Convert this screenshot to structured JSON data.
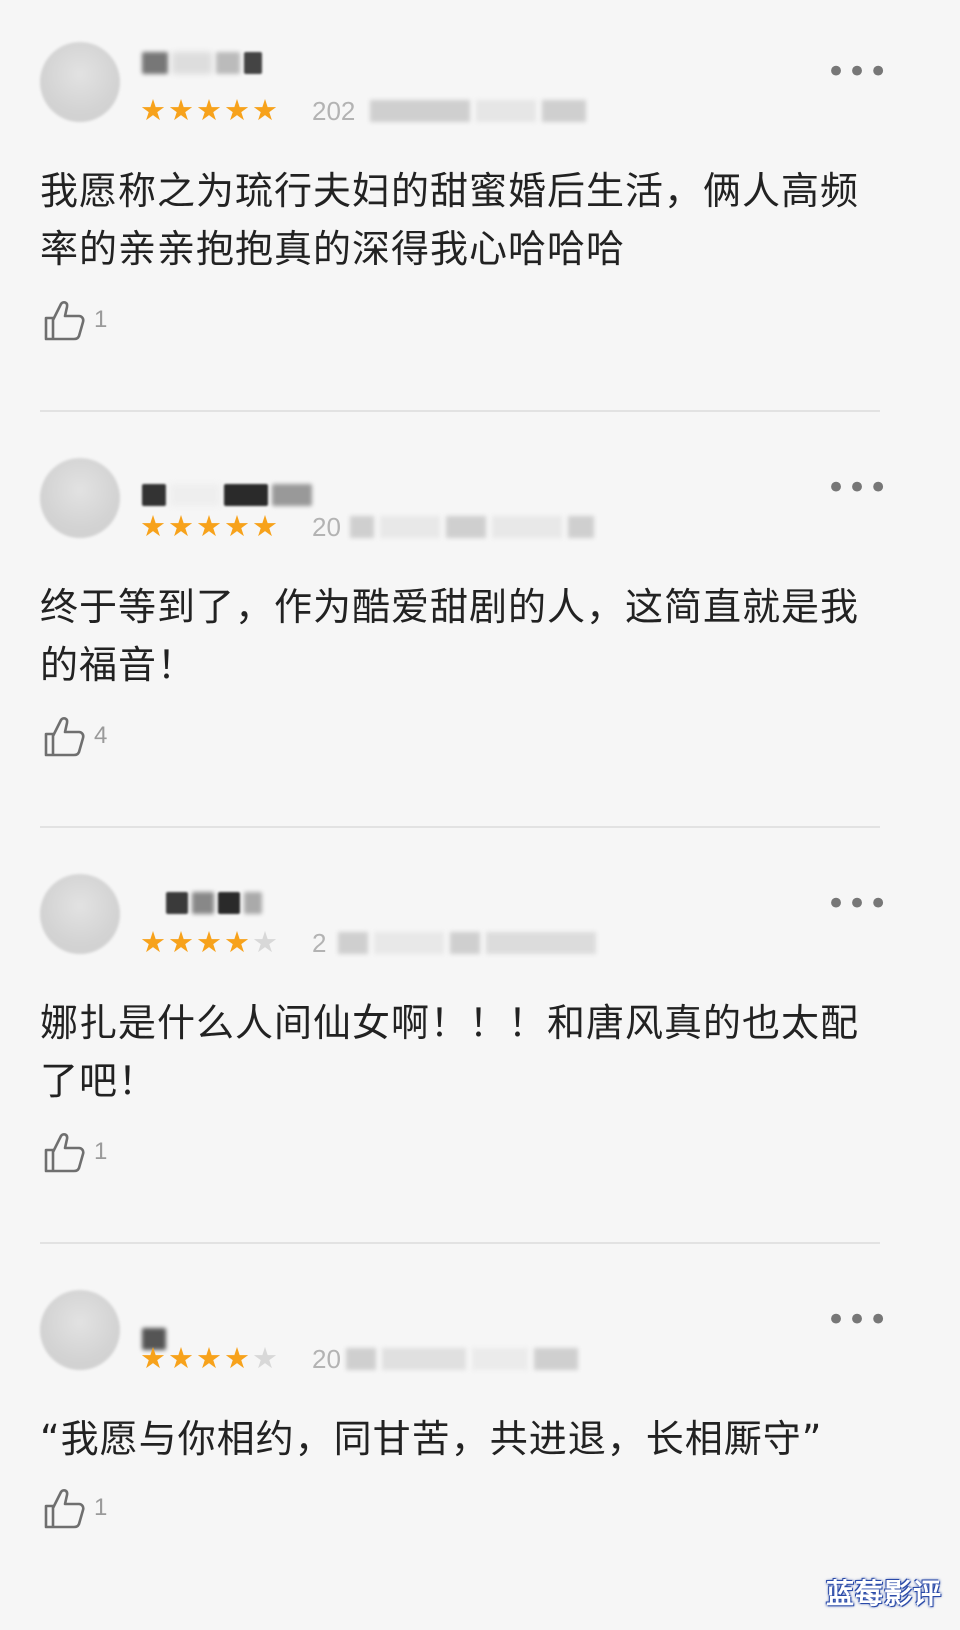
{
  "reviews": [
    {
      "stars": 5,
      "date_prefix": "202",
      "text": "我愿称之为琉行夫妇的甜蜜婚后生活，俩人高频率的亲亲抱抱真的深得我心哈哈哈",
      "likes": "1"
    },
    {
      "stars": 5,
      "date_prefix": "20",
      "text": "终于等到了，作为酷爱甜剧的人，这简直就是我的福音！",
      "likes": "4"
    },
    {
      "stars": 4,
      "date_prefix": "2",
      "text": "娜扎是什么人间仙女啊！！！和唐风真的也太配了吧！",
      "likes": "1"
    },
    {
      "stars": 4,
      "date_prefix": "20",
      "text": "“我愿与你相约，同甘苦，共进退，长相厮守”",
      "likes": "1"
    }
  ],
  "more_label": "•••",
  "watermark": "蓝莓影评",
  "colors": {
    "star_on": "#f7a21b",
    "star_off": "#d8d8d8",
    "divider": "#e2e2e2"
  },
  "icons": {
    "like": "thumbs-up-icon",
    "more": "more-dots-icon"
  }
}
